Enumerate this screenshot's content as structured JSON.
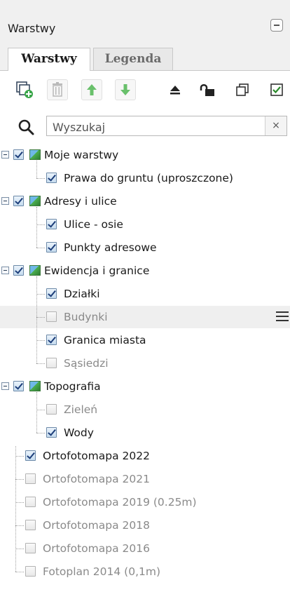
{
  "panel": {
    "title": "Warstwy"
  },
  "tabs": [
    {
      "label": "Warstwy",
      "active": true
    },
    {
      "label": "Legenda",
      "active": false
    }
  ],
  "toolbar": {
    "buttons": [
      "add-layer-icon",
      "delete-icon",
      "move-up-icon",
      "move-down-icon",
      "eject-icon",
      "unlock-icon",
      "collapse-all-icon",
      "check-all-icon"
    ]
  },
  "search": {
    "placeholder": "Wyszukaj",
    "value": "",
    "clear_label": "×"
  },
  "layers": [
    {
      "label": "Moje warstwy",
      "group": true,
      "checked": true
    },
    {
      "label": "Prawa do gruntu (uproszczone)",
      "group": false,
      "checked": true
    },
    {
      "label": "Adresy i ulice",
      "group": true,
      "checked": true
    },
    {
      "label": "Ulice - osie",
      "group": false,
      "checked": true
    },
    {
      "label": "Punkty adresowe",
      "group": false,
      "checked": true
    },
    {
      "label": "Ewidencja i granice",
      "group": true,
      "checked": true
    },
    {
      "label": "Działki",
      "group": false,
      "checked": true
    },
    {
      "label": "Budynki",
      "group": false,
      "checked": false
    },
    {
      "label": "Granica miasta",
      "group": false,
      "checked": true
    },
    {
      "label": "Sąsiedzi",
      "group": false,
      "checked": false
    },
    {
      "label": "Topografia",
      "group": true,
      "checked": true
    },
    {
      "label": "Zieleń",
      "group": false,
      "checked": false
    },
    {
      "label": "Wody",
      "group": false,
      "checked": true
    },
    {
      "label": "Ortofotomapa 2022",
      "group": false,
      "checked": true
    },
    {
      "label": "Ortofotomapa 2021",
      "group": false,
      "checked": false
    },
    {
      "label": "Ortofotomapa 2019 (0.25m)",
      "group": false,
      "checked": false
    },
    {
      "label": "Ortofotomapa 2018",
      "group": false,
      "checked": false
    },
    {
      "label": "Ortofotomapa 2016",
      "group": false,
      "checked": false
    },
    {
      "label": "Fotoplan 2014 (0,1m)",
      "group": false,
      "checked": false
    }
  ],
  "colors": {
    "checked_mark": "#1d3e7a",
    "disabled_text": "#8a8a8a",
    "highlight_row": "#efefef",
    "active_arrow": "#4caf50"
  }
}
